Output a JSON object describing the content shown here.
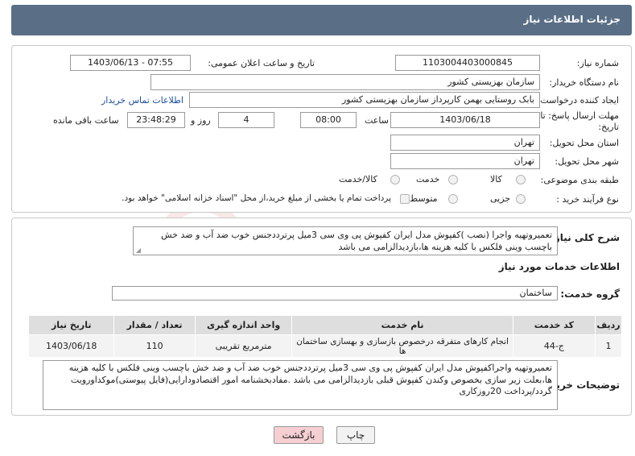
{
  "header": {
    "title": "جزئیات اطلاعات نیاز"
  },
  "form": {
    "need_number_label": "شماره نیاز:",
    "need_number": "1103004403000845",
    "announce_label": "تاریخ و ساعت اعلان عمومی:",
    "announce_value": "1403/06/13 - 07:55",
    "buyer_org_label": "نام دستگاه خریدار:",
    "buyer_org": "سازمان بهزیستی کشور",
    "creator_label": "ایجاد کننده درخواست:",
    "creator": "بابک  روستایی بهمن کارپرداز سازمان بهزیستی کشور",
    "contact_link": "اطلاعات تماس خریدار",
    "deadline_label_line1": "مهلت ارسال پاسخ: تا",
    "deadline_label_line2": "تاریخ:",
    "deadline_date": "1403/06/18",
    "time_label": "ساعت",
    "deadline_time": "08:00",
    "days_value": "4",
    "days_label": "روز و",
    "remaining_time": "23:48:29",
    "remaining_label": "ساعت باقی مانده",
    "province_label": "استان محل تحویل:",
    "province": "تهران",
    "city_label": "شهر محل تحویل:",
    "city": "تهران",
    "category_label": "طبقه بندی موضوعی:",
    "category_options": [
      "کالا",
      "خدمت",
      "کالا/خدمت"
    ],
    "process_label": "نوع فرآیند خرید :",
    "process_options": [
      "جزیی",
      "متوسط"
    ],
    "payment_note": "پرداخت تمام یا بخشی از مبلغ خرید،از محل \"اسناد خزانه اسلامی\" خواهد بود."
  },
  "summary": {
    "label": "شرح کلی نیاز:",
    "text": "تعمیروتهیه واجرا (نصب )کفپوش مدل ایران کفپوش پی وی سی 3میل پرترددجنس خوب ضد آب و ضد خش باچسب وینی فلکس با کلیه هزینه ها،بازدیدالزامی می باشد"
  },
  "services": {
    "section_title": "اطلاعات خدمات مورد نیاز",
    "group_label": "گروه خدمت:",
    "group_value": "ساختمان",
    "columns": [
      "ردیف",
      "کد خدمت",
      "نام خدمت",
      "واحد اندازه گیری",
      "تعداد / مقدار",
      "تاریخ نیاز"
    ],
    "rows": [
      {
        "row": "1",
        "code": "ج-44",
        "name": "انجام کارهای متفرقه درخصوص بازسازی و بهسازی ساختمان ها",
        "unit": "مترمربع تقریبی",
        "qty": "110",
        "date": "1403/06/18"
      }
    ]
  },
  "buyer_notes": {
    "label": "توضیحات خریدار:",
    "text": "تعمیروتهیه واجراکفپوش مدل ایران کفپوش پی وی سی 3میل پرترددجنس خوب ضد آب و ضد خش باچسب وینی فلکس با کلیه هزینه ها،بعلت زیر سازی بخصوص وکندن کفپوش قبلی بازدیدالزامی می باشد .مفادبخشنامه امور اقتصادودارایی(فایل پیوستی)موکداورویت گردد/پرداخت 20روزکاری"
  },
  "buttons": {
    "print": "چاپ",
    "back": "بازگشت"
  },
  "colors": {
    "header_bg": "#5a6f86",
    "back_button_bg": "#f6cfd3",
    "link": "#1a4fa0"
  }
}
